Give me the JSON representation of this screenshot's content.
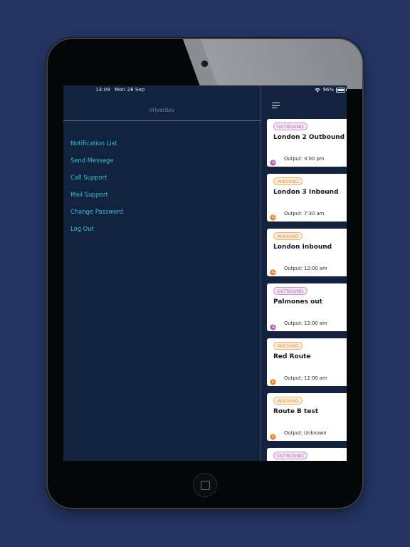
{
  "status_bar": {
    "time": "13:09",
    "date": "Mon 28 Sep",
    "battery": "96%",
    "battery_level": 0.96
  },
  "drawer": {
    "username": "driverdev",
    "menu": [
      {
        "label": "Notification List"
      },
      {
        "label": "Send Message"
      },
      {
        "label": "Call Support"
      },
      {
        "label": "Mail Support"
      },
      {
        "label": "Change Password"
      },
      {
        "label": "Log Out"
      }
    ]
  },
  "colors": {
    "outbound": "#b36bb2",
    "inbound": "#e68b2d",
    "menu_link": "#38c2d6"
  },
  "routes": [
    {
      "badge": "OUTBOUND",
      "type": "outbound",
      "title": "London 2 Outbound",
      "output": "Output: 3:00 pm"
    },
    {
      "badge": "INBOUND",
      "type": "inbound",
      "title": "London 3 Inbound",
      "output": "Output: 7:30 am"
    },
    {
      "badge": "INBOUND",
      "type": "inbound",
      "title": "London Inbound",
      "output": "Output: 12:00 am"
    },
    {
      "badge": "OUTBOUND",
      "type": "outbound",
      "title": "Palmones out",
      "output": "Output: 12:00 am"
    },
    {
      "badge": "INBOUND",
      "type": "inbound",
      "title": "Red Route",
      "output": "Output: 12:00 am"
    },
    {
      "badge": "INBOUND",
      "type": "inbound",
      "title": "Route B test",
      "output": "Output: Unknown"
    },
    {
      "badge": "OUTBOUND",
      "type": "outbound",
      "title": "",
      "output": ""
    }
  ]
}
